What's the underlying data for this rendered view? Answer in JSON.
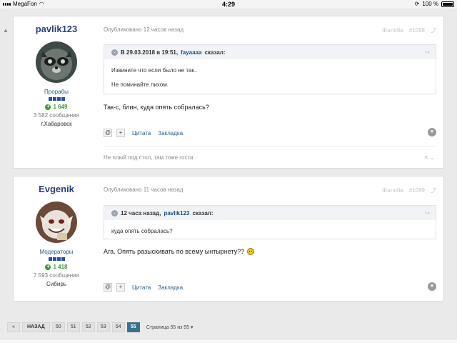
{
  "status_bar": {
    "carrier": "MegaFon",
    "time": "4:29",
    "battery": "100 %"
  },
  "posts": [
    {
      "author": "pavlik123",
      "role": "Прорабы",
      "reputation": "1 649",
      "messages": "3 582 сообщения",
      "location": "г.Хабаровск",
      "posted": "Опубликовано 12 часов назад",
      "report": "Жалоба",
      "number": "#1098",
      "quote": {
        "date": "В 29.03.2018 в 19:51,",
        "name": "fayaaaa",
        "said": "сказал:",
        "lines": [
          "Извините что если было не так..",
          "Не поминайте лихом."
        ]
      },
      "text": "Так-с, блин, куда опять собралась?",
      "signature": "Не плюй под стол, там тоже гости"
    },
    {
      "author": "Evgenik",
      "role": "Модераторы",
      "reputation": "1 418",
      "messages": "7 593 сообщения",
      "location": "Сибирь",
      "posted": "Опубликовано 11 часов назад",
      "report": "Жалоба",
      "number": "#1099",
      "quote": {
        "date": "12 часа назад,",
        "name": "pavlik123",
        "said": "сказал:",
        "lines": [
          "куда опять собралась?"
        ]
      },
      "text": "Ага. Опять разыскивать по всему ынтырнету??"
    }
  ],
  "actions": {
    "quote_label": "Цитата",
    "bookmark_label": "Закладка",
    "mention": "@",
    "plus": "+"
  },
  "pagination": {
    "first": "«",
    "prev": "НАЗАД",
    "pages": [
      "50",
      "51",
      "52",
      "53",
      "54",
      "55"
    ],
    "current": "55",
    "info": "Страница 55 из 55"
  }
}
